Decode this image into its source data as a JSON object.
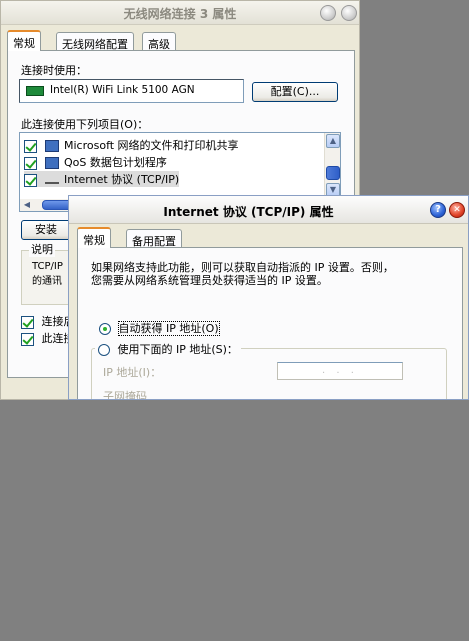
{
  "back_window": {
    "title": "无线网络连接 3 属性",
    "tabs": [
      "常规",
      "无线网络配置",
      "高级"
    ],
    "connect_using_label": "连接时使用：",
    "adapter_name": "Intel(R) WiFi Link 5100 AGN",
    "configure_button": "配置(C)...",
    "items_label": "此连接使用下列项目(O)：",
    "items": [
      {
        "label": "Microsoft 网络的文件和打印机共享",
        "checked": true
      },
      {
        "label": "QoS 数据包计划程序",
        "checked": true
      },
      {
        "label": "Internet 协议 (TCP/IP)",
        "checked": true
      }
    ],
    "install_button": "安装",
    "description_group": "说明",
    "description_lines": [
      "TCP/IP",
      "的通讯"
    ],
    "checkbox_1_label": "连接后",
    "checkbox_2_label": "此连接"
  },
  "front_dialog": {
    "title": "Internet 协议 (TCP/IP) 属性",
    "help_icon": "help-icon",
    "close_icon": "close-icon",
    "tabs": [
      "常规",
      "备用配置"
    ],
    "intro_line_1": "如果网络支持此功能，则可以获取自动指派的 IP 设置。否则，",
    "intro_line_2": "您需要从网络系统管理员处获得适当的 IP 设置。",
    "radio_auto": "自动获得 IP 地址(O)",
    "radio_manual": "使用下面的 IP 地址(S)：",
    "ip_label": "IP 地址(I)：",
    "ip_value": ". . .",
    "subnet_label": "子网掩码"
  },
  "colors": {
    "background_gray": "#808080",
    "dialog_face": "#ece9d8",
    "tab_highlight": "#e68b2c"
  }
}
